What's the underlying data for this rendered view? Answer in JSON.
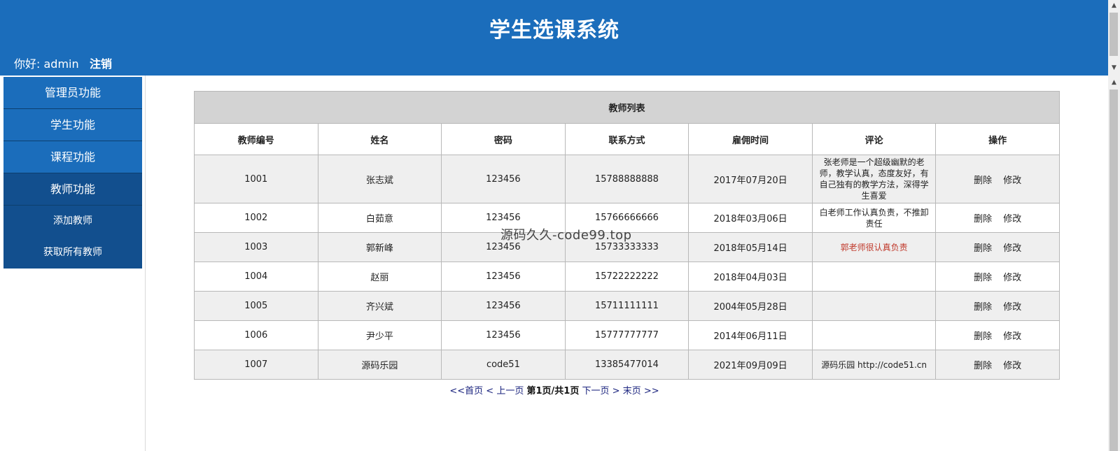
{
  "header": {
    "title": "学生选课系统",
    "greeting": "你好: admin",
    "logout": "注销"
  },
  "sidebar": {
    "items": [
      {
        "label": "管理员功能"
      },
      {
        "label": "学生功能"
      },
      {
        "label": "课程功能"
      },
      {
        "label": "教师功能"
      }
    ],
    "subitems": [
      {
        "label": "添加教师"
      },
      {
        "label": "获取所有教师"
      }
    ]
  },
  "table": {
    "caption": "教师列表",
    "columns": [
      "教师编号",
      "姓名",
      "密码",
      "联系方式",
      "雇佣时间",
      "评论",
      "操作"
    ],
    "delete_label": "删除",
    "edit_label": "修改",
    "rows": [
      {
        "id": "1001",
        "name": "张志斌",
        "password": "123456",
        "phone": "15788888888",
        "hire_date": "2017年07月20日",
        "comment": "张老师是一个超级幽默的老师，教学认真，态度友好，有自己独有的教学方法，深得学生喜爱"
      },
      {
        "id": "1002",
        "name": "白茹意",
        "password": "123456",
        "phone": "15766666666",
        "hire_date": "2018年03月06日",
        "comment": "白老师工作认真负责，不推卸责任"
      },
      {
        "id": "1003",
        "name": "郭新峰",
        "password": "123456",
        "phone": "15733333333",
        "hire_date": "2018年05月14日",
        "comment": "郭老师很认真负责"
      },
      {
        "id": "1004",
        "name": "赵丽",
        "password": "123456",
        "phone": "15722222222",
        "hire_date": "2018年04月03日",
        "comment": ""
      },
      {
        "id": "1005",
        "name": "齐兴斌",
        "password": "123456",
        "phone": "15711111111",
        "hire_date": "2004年05月28日",
        "comment": ""
      },
      {
        "id": "1006",
        "name": "尹少平",
        "password": "123456",
        "phone": "15777777777",
        "hire_date": "2014年06月11日",
        "comment": ""
      },
      {
        "id": "1007",
        "name": "源码乐园",
        "password": "code51",
        "phone": "13385477014",
        "hire_date": "2021年09月09日",
        "comment": "源码乐园 http://code51.cn"
      }
    ]
  },
  "watermark": "源码久久-code99.top",
  "pager": {
    "first": "<<首页",
    "prev_arrow": "<",
    "prev": "上一页",
    "current": "第1页/共1页",
    "next": "下一页",
    "next_arrow": ">",
    "last": "末页",
    "last_arrow": ">>"
  },
  "colors": {
    "header_bg": "#1b6dbb",
    "sidebar_active": "#124f8e",
    "highlight_comment": "#c0392b"
  }
}
